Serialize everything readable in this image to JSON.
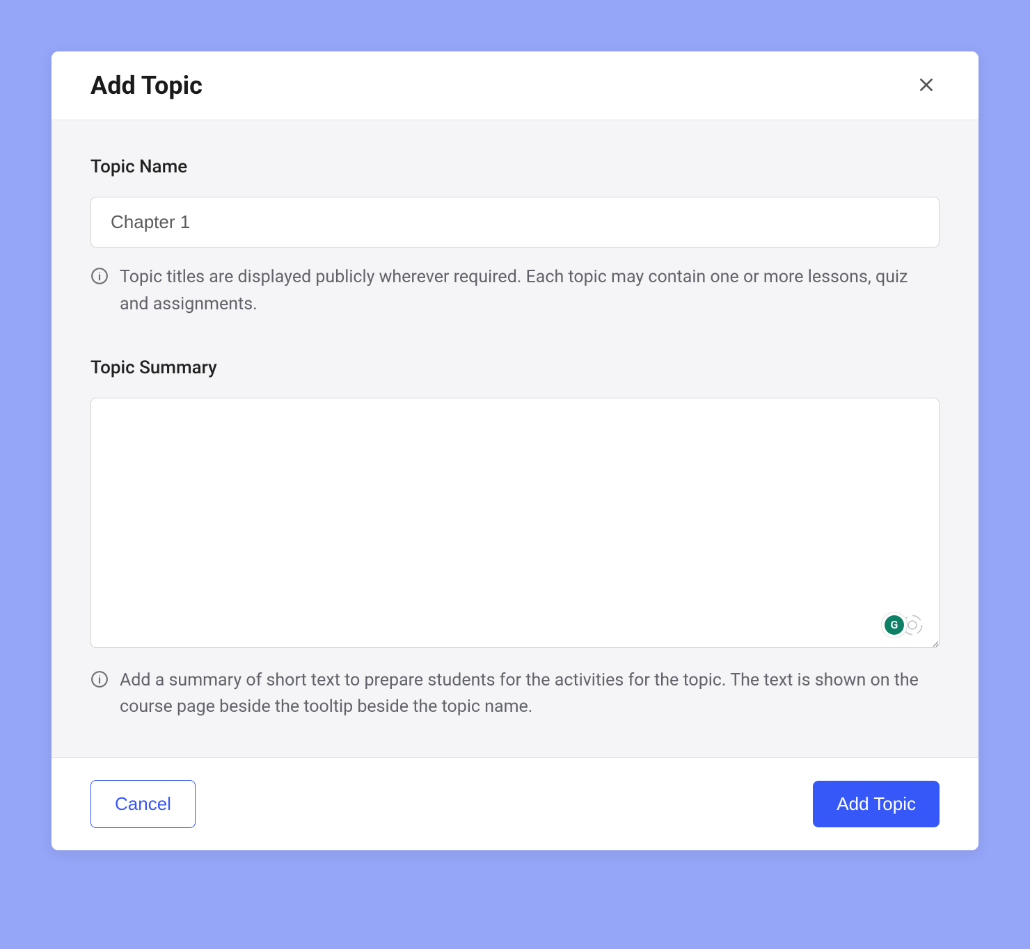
{
  "modal": {
    "title": "Add Topic",
    "topic_name": {
      "label": "Topic Name",
      "value": "Chapter 1",
      "help": "Topic titles are displayed publicly wherever required. Each topic may contain one or more lessons, quiz and assignments."
    },
    "topic_summary": {
      "label": "Topic Summary",
      "value": "",
      "help": "Add a summary of short text to prepare students for the activities for the topic. The text is shown on the course page beside the tooltip beside the topic name."
    },
    "footer": {
      "cancel_label": "Cancel",
      "submit_label": "Add Topic"
    }
  }
}
